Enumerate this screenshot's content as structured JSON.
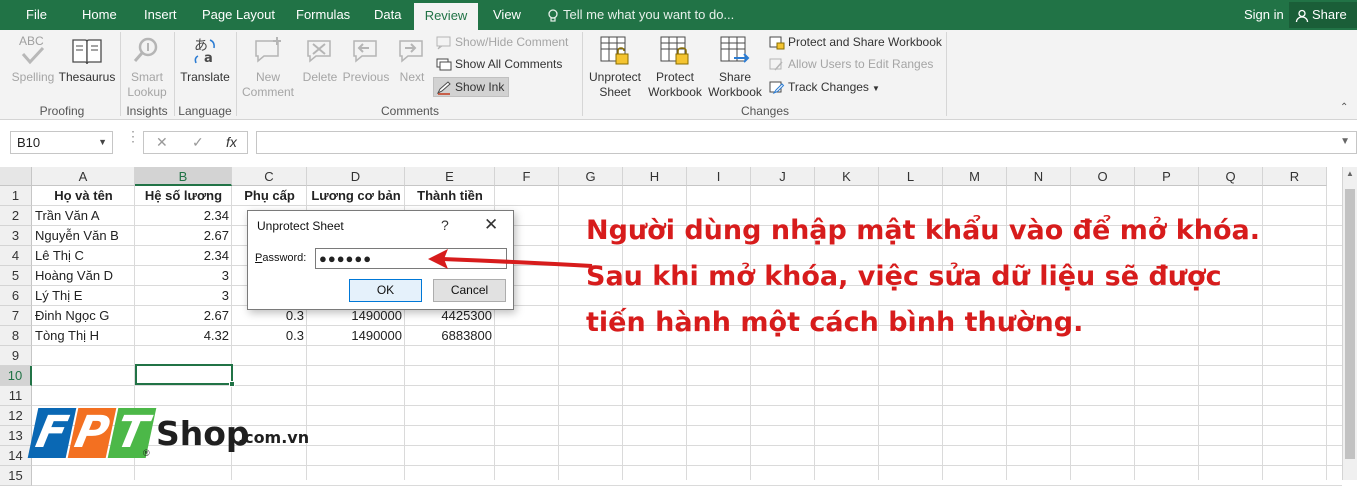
{
  "ribbon_tabs": [
    {
      "label": "File"
    },
    {
      "label": "Home"
    },
    {
      "label": "Insert"
    },
    {
      "label": "Page Layout"
    },
    {
      "label": "Formulas"
    },
    {
      "label": "Data"
    },
    {
      "label": "Review",
      "active": true
    },
    {
      "label": "View"
    }
  ],
  "tell_me": "Tell me what you want to do...",
  "sign_in": "Sign in",
  "share": "Share",
  "ribbon": {
    "proofing": {
      "spelling_line1": "ABC",
      "spelling": "Spelling",
      "thesaurus": "Thesaurus",
      "group": "Proofing"
    },
    "insights": {
      "smart_1": "Smart",
      "smart_2": "Lookup",
      "group": "Insights"
    },
    "language": {
      "translate": "Translate",
      "group": "Language"
    },
    "comments": {
      "new_1": "New",
      "new_2": "Comment",
      "delete": "Delete",
      "previous": "Previous",
      "next": "Next",
      "show_hide": "Show/Hide Comment",
      "show_all": "Show All Comments",
      "show_ink": "Show Ink",
      "group": "Comments"
    },
    "changes": {
      "unprotect_1": "Unprotect",
      "unprotect_2": "Sheet",
      "protect_1": "Protect",
      "protect_2": "Workbook",
      "share_1": "Share",
      "share_2": "Workbook",
      "protect_share": "Protect and Share Workbook",
      "allow_users": "Allow Users to Edit Ranges",
      "track_changes": "Track Changes",
      "group": "Changes"
    }
  },
  "formula_bar": {
    "name_box": "B10",
    "cancel": "✕",
    "enter": "✓",
    "fx": "fx",
    "value": ""
  },
  "columns": [
    "A",
    "B",
    "C",
    "D",
    "E",
    "F",
    "G",
    "H",
    "I",
    "J",
    "K",
    "L",
    "M",
    "N",
    "O",
    "P",
    "Q",
    "R"
  ],
  "selected_column": "B",
  "rows": [
    "1",
    "2",
    "3",
    "4",
    "5",
    "6",
    "7",
    "8",
    "9",
    "10",
    "11",
    "12",
    "13",
    "14",
    "15"
  ],
  "selected_row": "10",
  "table": {
    "headers": [
      "Họ và tên",
      "Hệ số lương",
      "Phụ cấp",
      "Lương cơ bản",
      "Thành tiền"
    ],
    "rows": [
      [
        "Trần Văn A",
        "2.34",
        "",
        "",
        ""
      ],
      [
        "Nguyễn Văn B",
        "2.67",
        "",
        "",
        ""
      ],
      [
        "Lê Thị C",
        "2.34",
        "",
        "",
        ""
      ],
      [
        "Hoàng Văn D",
        "3",
        "",
        "",
        ""
      ],
      [
        "Lý Thị E",
        "3",
        "",
        "",
        ""
      ],
      [
        "Đinh Ngọc G",
        "2.67",
        "0.3",
        "1490000",
        "4425300"
      ],
      [
        "Tòng Thị H",
        "4.32",
        "0.3",
        "1490000",
        "6883800"
      ]
    ]
  },
  "dialog": {
    "title": "Unprotect Sheet",
    "help": "?",
    "close": "✕",
    "password_label": "Password:",
    "password_value": "●●●●●●",
    "ok": "OK",
    "cancel": "Cancel"
  },
  "annotation": {
    "line1": "Người dùng nhập mật khẩu vào để mở khóa.",
    "line2": "Sau khi mở khóa, việc sửa dữ liệu sẽ được",
    "line3": "tiến hành một cách bình thường.",
    "color": "#d71c1c"
  },
  "logo": {
    "letters": [
      "F",
      "P",
      "T"
    ],
    "shop": "Shop",
    "domain": ".com.vn",
    "reg": "®",
    "colors": [
      "#0a68b4",
      "#f37021",
      "#4cb848"
    ]
  },
  "colors": {
    "accent": "#217346"
  }
}
